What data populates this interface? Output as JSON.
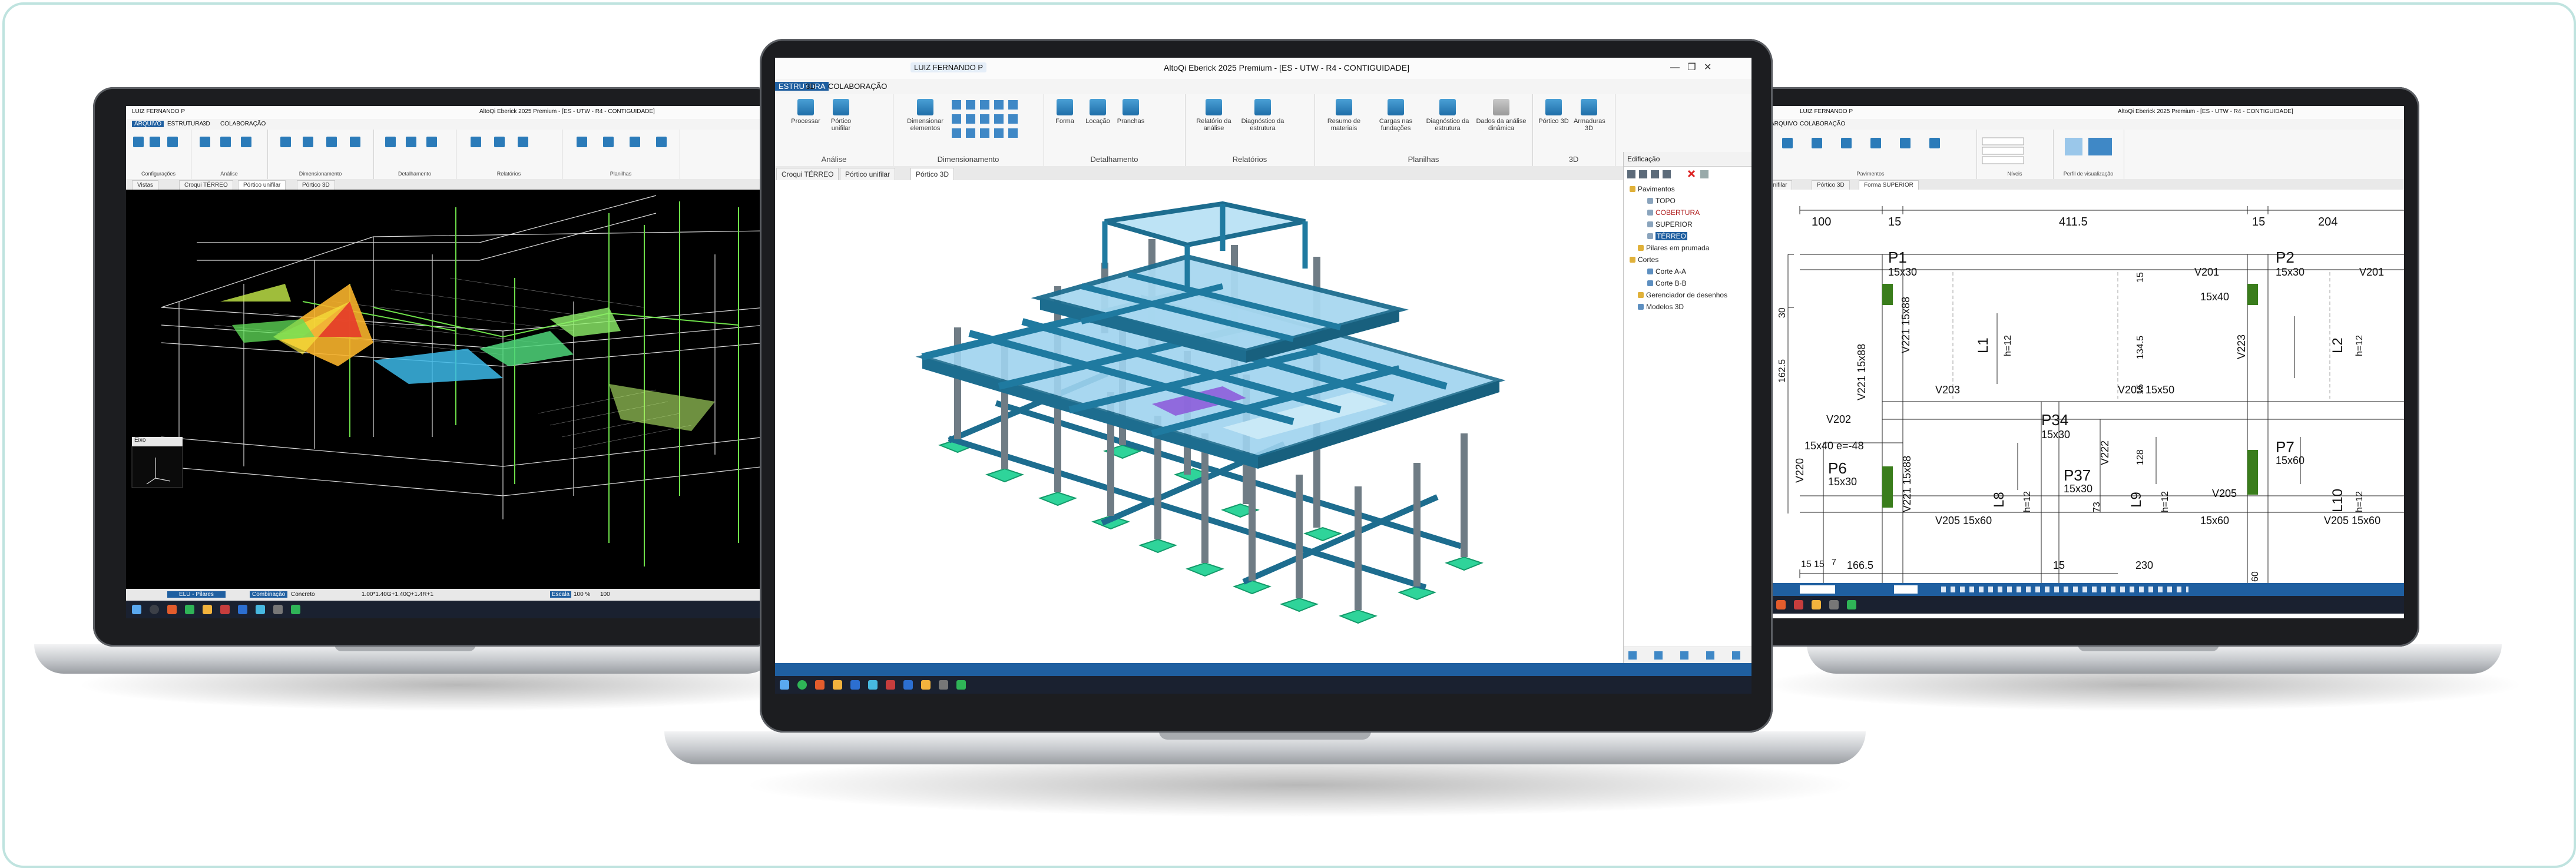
{
  "left_screen": {
    "title": "AltoQi Eberick 2025 Premium - [ES - UTW - R4 - CONTIGUIDADE]",
    "user_badge": "LUIZ FERNANDO P",
    "tabs": [
      "ARQUIVO",
      "ESTRUTURA",
      "3D",
      "COLABORAÇÃO"
    ],
    "groups": [
      "Configurações",
      "Análise",
      "Dimensionamento",
      "Detalhamento",
      "Relatórios",
      "Planilhas"
    ],
    "doc_tabs": [
      "Vistas",
      "Croqui TÉRREO",
      "Pórtico unifilar",
      "Pórtico 3D"
    ],
    "view_label": "Eixo",
    "status": {
      "combo_label": "ELU - Pilares",
      "combination_label": "Combinação",
      "material_label": "Concreto",
      "formula": "1.00*1.40G+1.40Q+1.4R+1",
      "scale_label": "Escala",
      "scale_value": "100 %",
      "max_value": "100"
    }
  },
  "center_screen": {
    "title": "AltoQi Eberick 2025 Premium - [ES - UTW - R4 - CONTIGUIDADE]",
    "user_badge": "LUIZ FERNANDO P",
    "tabs": [
      "ESTRUTURA",
      "3D",
      "COLABORAÇÃO"
    ],
    "ribbon_groups": [
      {
        "label": "Análise",
        "buttons": [
          "Processar",
          "Pórtico unifilar"
        ]
      },
      {
        "label": "Dimensionamento",
        "buttons": [
          "Dimensionar elementos"
        ]
      },
      {
        "label": "Detalhamento",
        "buttons": [
          "Forma",
          "Locação",
          "Pranchas"
        ]
      },
      {
        "label": "Relatórios",
        "buttons": [
          "Relatório da análise",
          "Diagnóstico da estrutura"
        ]
      },
      {
        "label": "Planilhas",
        "buttons": [
          "Resumo de materiais",
          "Cargas nas fundações",
          "Diagnóstico da estrutura",
          "Dados da análise dinâmica"
        ]
      },
      {
        "label": "3D",
        "buttons": [
          "Pórtico 3D",
          "Armaduras 3D"
        ]
      }
    ],
    "doc_tabs": [
      "Croqui TÉRREO",
      "Pórtico unifilar",
      "Pórtico 3D"
    ],
    "panel": {
      "title": "Edificação",
      "tree": [
        {
          "label": "Pavimentos",
          "level": 0
        },
        {
          "label": "TOPO",
          "level": 2
        },
        {
          "label": "COBERTURA",
          "level": 2
        },
        {
          "label": "SUPERIOR",
          "level": 2
        },
        {
          "label": "TÉRREO",
          "level": 2,
          "selected": true
        },
        {
          "label": "Pilares em prumada",
          "level": 1
        },
        {
          "label": "Cortes",
          "level": 0
        },
        {
          "label": "Corte A-A",
          "level": 2
        },
        {
          "label": "Corte B-B",
          "level": 2
        },
        {
          "label": "Gerenciador de desenhos",
          "level": 1
        },
        {
          "label": "Modelos 3D",
          "level": 1
        }
      ]
    }
  },
  "right_screen": {
    "title": "AltoQi Eberick 2025 Premium - [ES - UTW - R4 - CONTIGUIDADE]",
    "user_badge": "LUIZ FERNANDO P",
    "tabs": [
      "ARQUIVO",
      "COLABORAÇÃO"
    ],
    "groups": [
      "Pavimentos",
      "Níveis",
      "Perfil de visualização"
    ],
    "doc_tabs": [
      "unifilar",
      "Pórtico 3D",
      "Forma SUPERIOR"
    ],
    "dims_top": [
      "100",
      "15",
      "411.5",
      "15",
      "204"
    ],
    "pillars": [
      {
        "name": "P1",
        "size": "15x30"
      },
      {
        "name": "P2",
        "size": "15x30"
      },
      {
        "name": "P34",
        "size": "15x30"
      },
      {
        "name": "P6",
        "size": "15x30"
      },
      {
        "name": "P37",
        "size": "15x30"
      },
      {
        "name": "P7",
        "size": "15x60"
      }
    ],
    "beams": [
      "V201",
      "V201",
      "15x40",
      "V203",
      "V203 15x50",
      "V221 15x88",
      "V221 15x88",
      "V223",
      "V220",
      "V202",
      "15x40 e=-48",
      "V222",
      "V221 15x88",
      "V205",
      "V205 15x60",
      "15x60",
      "V205 15x60"
    ],
    "slabs": [
      {
        "name": "L1",
        "h": "h=12"
      },
      {
        "name": "L2",
        "h": "h=12"
      },
      {
        "name": "L8",
        "h": "h=12"
      },
      {
        "name": "L9",
        "h": "h=12"
      },
      {
        "name": "L10",
        "h": "h=12"
      }
    ],
    "dims_misc": [
      "30",
      "162.5",
      "15",
      "134.5",
      "15",
      "128",
      "73",
      "166.5",
      "15",
      "230",
      "15",
      "15",
      "60",
      "7"
    ]
  }
}
